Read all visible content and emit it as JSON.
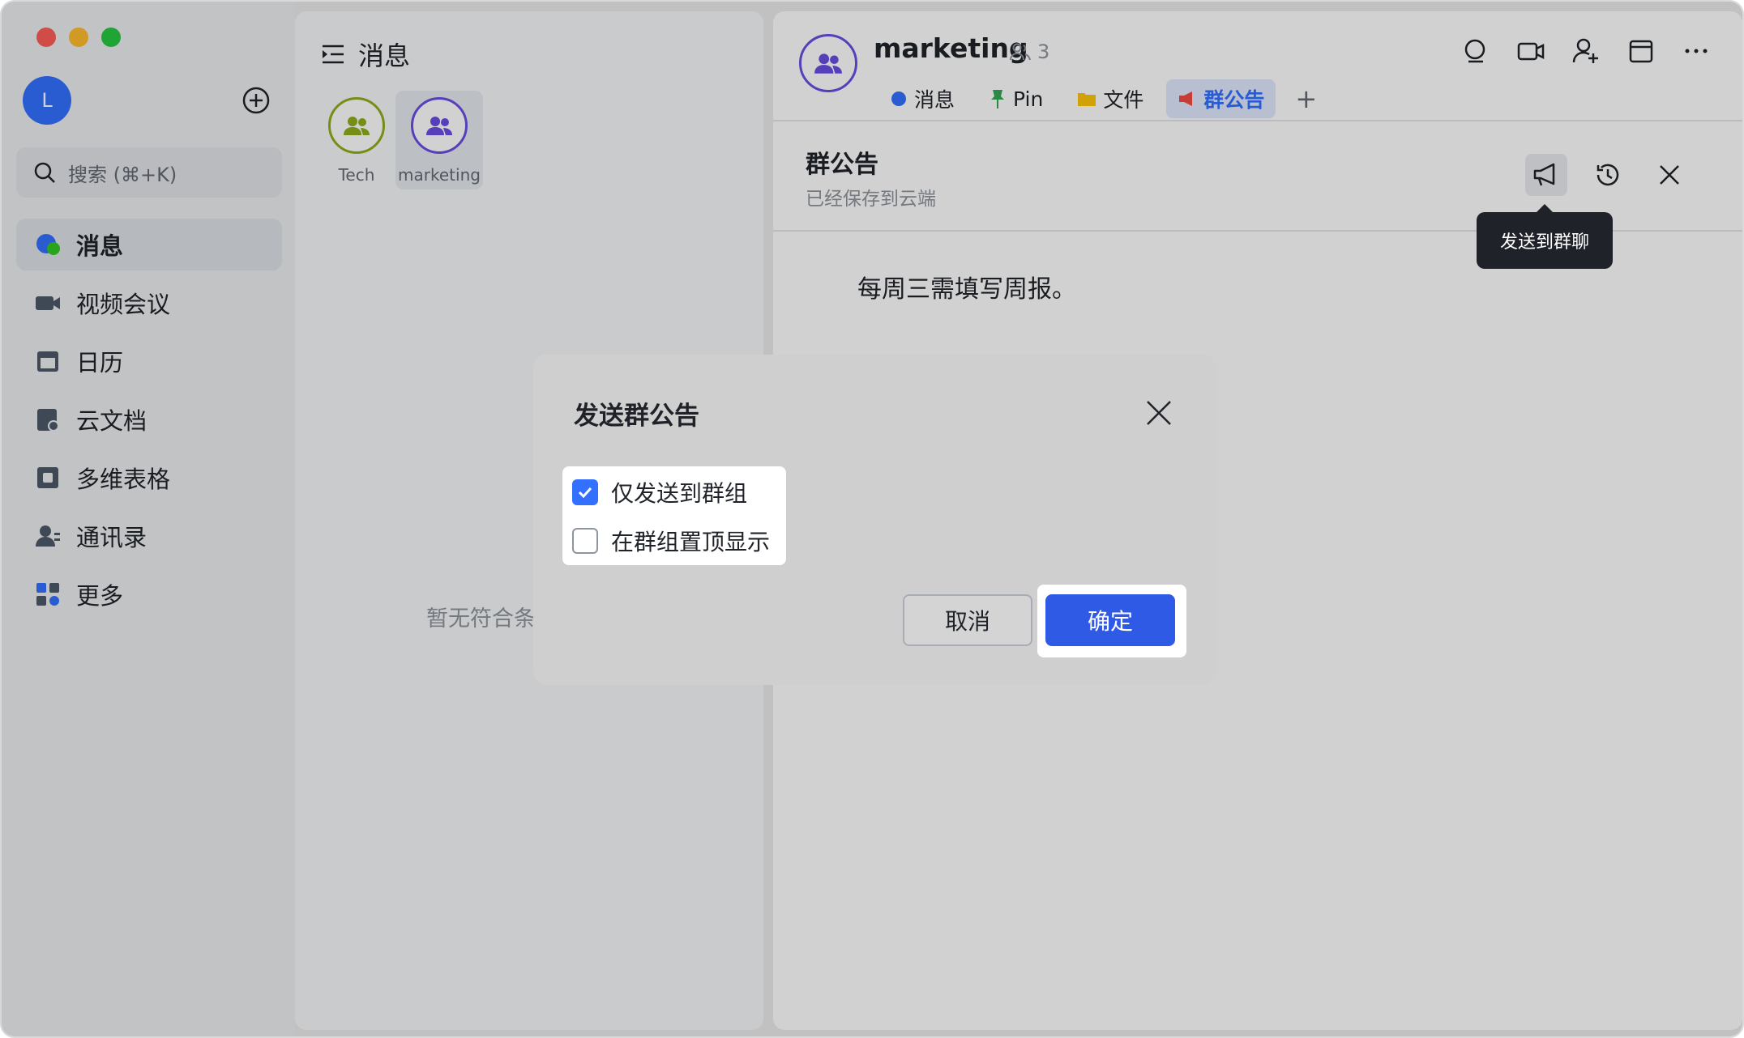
{
  "sidebar": {
    "avatar_letter": "L",
    "search_placeholder": "搜索 (⌘+K)",
    "nav": [
      {
        "label": "消息",
        "icon": "chat-bubble-icon",
        "active": true
      },
      {
        "label": "视频会议",
        "icon": "video-camera-icon"
      },
      {
        "label": "日历",
        "icon": "calendar-icon"
      },
      {
        "label": "云文档",
        "icon": "cloud-doc-icon"
      },
      {
        "label": "多维表格",
        "icon": "base-table-icon"
      },
      {
        "label": "通讯录",
        "icon": "contacts-icon"
      },
      {
        "label": "更多",
        "icon": "more-apps-icon"
      }
    ]
  },
  "list_panel": {
    "title": "消息",
    "groups": [
      {
        "name": "Tech",
        "ring_color": "#8fae1b"
      },
      {
        "name": "marketing",
        "ring_color": "#6b4ee6",
        "selected": true
      }
    ],
    "empty_text": "暂无符合条"
  },
  "chat": {
    "title": "marketing",
    "member_count": "3",
    "tabs": [
      {
        "label": "消息",
        "icon": "chat-icon"
      },
      {
        "label": "Pin",
        "icon": "pin-icon"
      },
      {
        "label": "文件",
        "icon": "folder-icon"
      },
      {
        "label": "群公告",
        "icon": "megaphone-icon",
        "active": true
      }
    ],
    "announcement": {
      "title": "群公告",
      "saved_status": "已经保存到云端",
      "body": "每周三需填写周报。",
      "tooltip": "发送到群聊"
    }
  },
  "dialog": {
    "title": "发送群公告",
    "options": [
      {
        "label": "仅发送到群组",
        "checked": true
      },
      {
        "label": "在群组置顶显示",
        "checked": false
      }
    ],
    "cancel_label": "取消",
    "confirm_label": "确定"
  },
  "colors": {
    "accent": "#3370ff",
    "confirm": "#2f5ae5"
  }
}
